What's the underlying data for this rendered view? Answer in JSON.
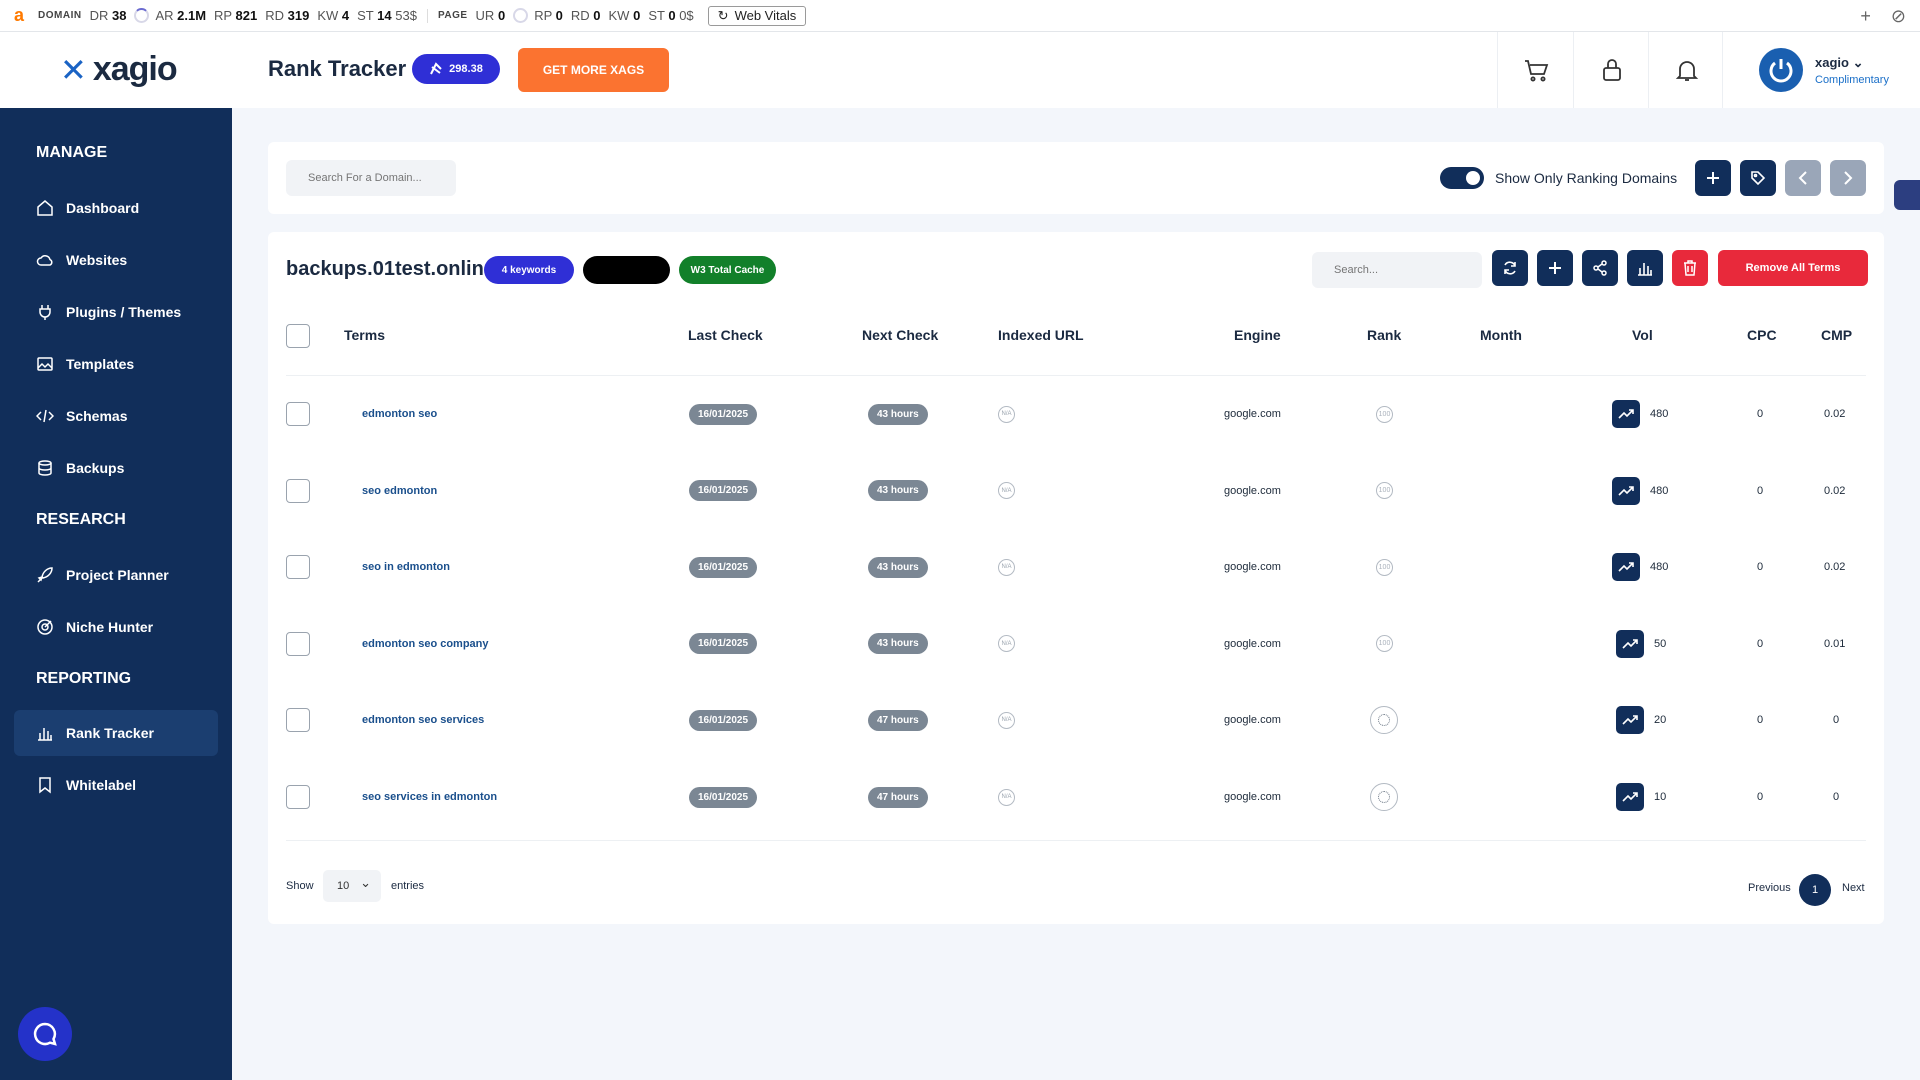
{
  "ahrefs": {
    "logo": "a",
    "domain_label": "DOMAIN",
    "dr_label": "DR",
    "dr": "38",
    "ar_label": "AR",
    "ar": "2.1M",
    "rp_label": "RP",
    "rp": "821",
    "rd_label": "RD",
    "rd": "319",
    "kw_label": "KW",
    "kw": "4",
    "st_label": "ST",
    "st": "14",
    "st_value": "53$",
    "page_label": "PAGE",
    "ur_label": "UR",
    "ur": "0",
    "prp_label": "RP",
    "prp": "0",
    "prd_label": "RD",
    "prd": "0",
    "pkw_label": "KW",
    "pkw": "0",
    "pst_label": "ST",
    "pst": "0",
    "pst_value": "0$",
    "web_vitals": "Web Vitals"
  },
  "header": {
    "logo_text": "xagio",
    "title": "Rank Tracker",
    "xags": "298.38",
    "get_more": "GET MORE XAGS",
    "user_name": "xagio",
    "user_plan": "Complimentary"
  },
  "sidebar": {
    "manage": "MANAGE",
    "research": "RESEARCH",
    "reporting": "REPORTING",
    "items": {
      "dashboard": "Dashboard",
      "websites": "Websites",
      "plugins": "Plugins / Themes",
      "templates": "Templates",
      "schemas": "Schemas",
      "backups": "Backups",
      "project_planner": "Project Planner",
      "niche_hunter": "Niche Hunter",
      "rank_tracker": "Rank Tracker",
      "whitelabel": "Whitelabel"
    }
  },
  "filters": {
    "domain_search_placeholder": "Search For a Domain...",
    "show_only_ranking": "Show Only Ranking Domains",
    "toggle_on": true
  },
  "domain_card": {
    "domain": "backups.01test.online",
    "keywords_badge": "4 keywords",
    "cache_badge": "W3 Total Cache",
    "search_placeholder": "Search...",
    "remove_all": "Remove All Terms"
  },
  "table": {
    "headers": {
      "terms": "Terms",
      "last_check": "Last Check",
      "next_check": "Next Check",
      "indexed_url": "Indexed URL",
      "engine": "Engine",
      "rank": "Rank",
      "month": "Month",
      "vol": "Vol",
      "cpc": "CPC",
      "cmp": "CMP"
    },
    "rows": [
      {
        "term": "edmonton seo",
        "last_check": "16/01/2025",
        "next_check": "43 hours",
        "indexed": "N/A",
        "engine": "google.com",
        "rank": "100",
        "vol": "480",
        "cpc": "0",
        "cmp": "0.02"
      },
      {
        "term": "seo edmonton",
        "last_check": "16/01/2025",
        "next_check": "43 hours",
        "indexed": "N/A",
        "engine": "google.com",
        "rank": "100",
        "vol": "480",
        "cpc": "0",
        "cmp": "0.02"
      },
      {
        "term": "seo in edmonton",
        "last_check": "16/01/2025",
        "next_check": "43 hours",
        "indexed": "N/A",
        "engine": "google.com",
        "rank": "100",
        "vol": "480",
        "cpc": "0",
        "cmp": "0.02"
      },
      {
        "term": "edmonton seo company",
        "last_check": "16/01/2025",
        "next_check": "43 hours",
        "indexed": "N/A",
        "engine": "google.com",
        "rank": "100",
        "vol": "50",
        "cpc": "0",
        "cmp": "0.01"
      },
      {
        "term": "edmonton seo services",
        "last_check": "16/01/2025",
        "next_check": "47 hours",
        "indexed": "N/A",
        "engine": "google.com",
        "rank": "",
        "vol": "20",
        "cpc": "0",
        "cmp": "0"
      },
      {
        "term": "seo services in edmonton",
        "last_check": "16/01/2025",
        "next_check": "47 hours",
        "indexed": "N/A",
        "engine": "google.com",
        "rank": "",
        "vol": "10",
        "cpc": "0",
        "cmp": "0"
      }
    ]
  },
  "pagination": {
    "show": "Show",
    "entries_value": "10",
    "entries": "entries",
    "previous": "Previous",
    "current": "1",
    "next": "Next"
  }
}
